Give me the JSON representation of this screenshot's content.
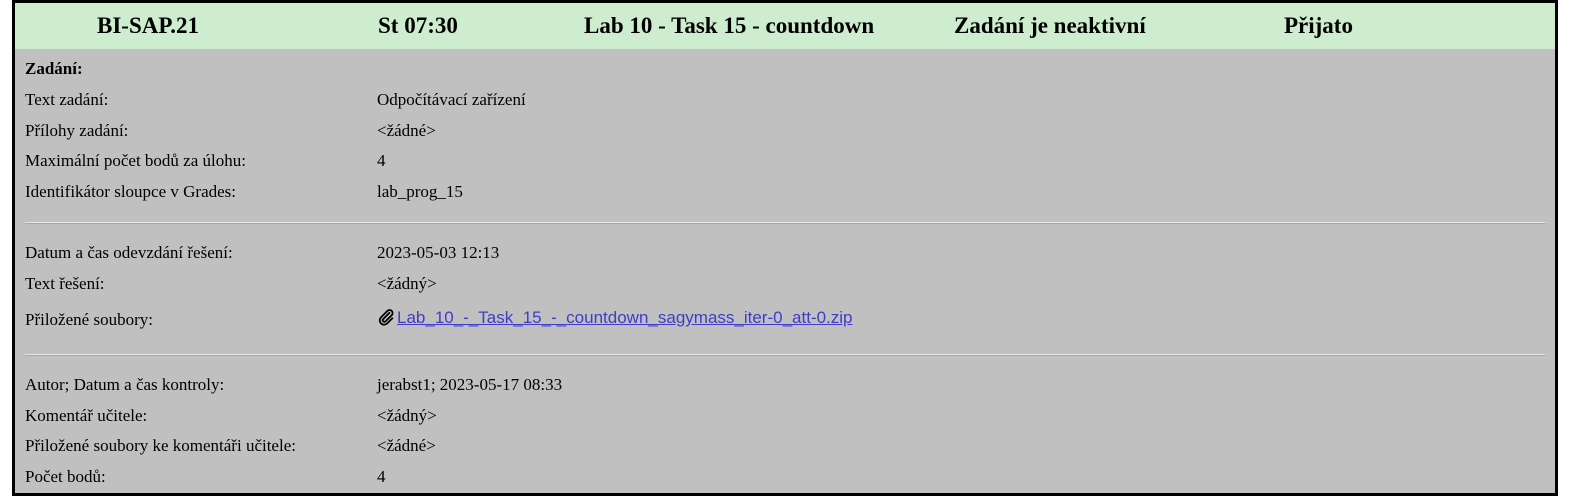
{
  "header": {
    "course": "BI-SAP.21",
    "slot": "St 07:30",
    "task": "Lab 10 - Task 15 - countdown",
    "state": "Zadání je neaktivní",
    "status": "Přijato"
  },
  "assignment": {
    "section_title": "Zadání:",
    "text_label": "Text zadání:",
    "text_value": "Odpočítávací zařízení",
    "attachments_label": "Přílohy zadání:",
    "attachments_value": "<žádné>",
    "max_points_label": "Maximální počet bodů za úlohu:",
    "max_points_value": "4",
    "column_id_label": "Identifikátor sloupce v Grades:",
    "column_id_value": "lab_prog_15"
  },
  "submission": {
    "datetime_label": "Datum a čas odevzdání řešení:",
    "datetime_value": "2023-05-03 12:13",
    "text_label": "Text řešení:",
    "text_value": "<žádný>",
    "files_label": "Přiložené soubory:",
    "file_name": "Lab_10_-_Task_15_-_countdown_sagymass_iter-0_att-0.zip",
    "file_icon": "paperclip-icon"
  },
  "review": {
    "author_label": "Autor; Datum a čas kontroly:",
    "author_value": "jerabst1; 2023-05-17 08:33",
    "comment_label": "Komentář učitele:",
    "comment_value": "<žádný>",
    "comment_files_label": "Přiložené soubory ke komentáři učitele:",
    "comment_files_value": "<žádné>",
    "points_label": "Počet bodů:",
    "points_value": "4"
  },
  "colors": {
    "header_bg": "#cdedce",
    "panel_bg": "#c0c0c0",
    "link": "#3d3dc9"
  }
}
